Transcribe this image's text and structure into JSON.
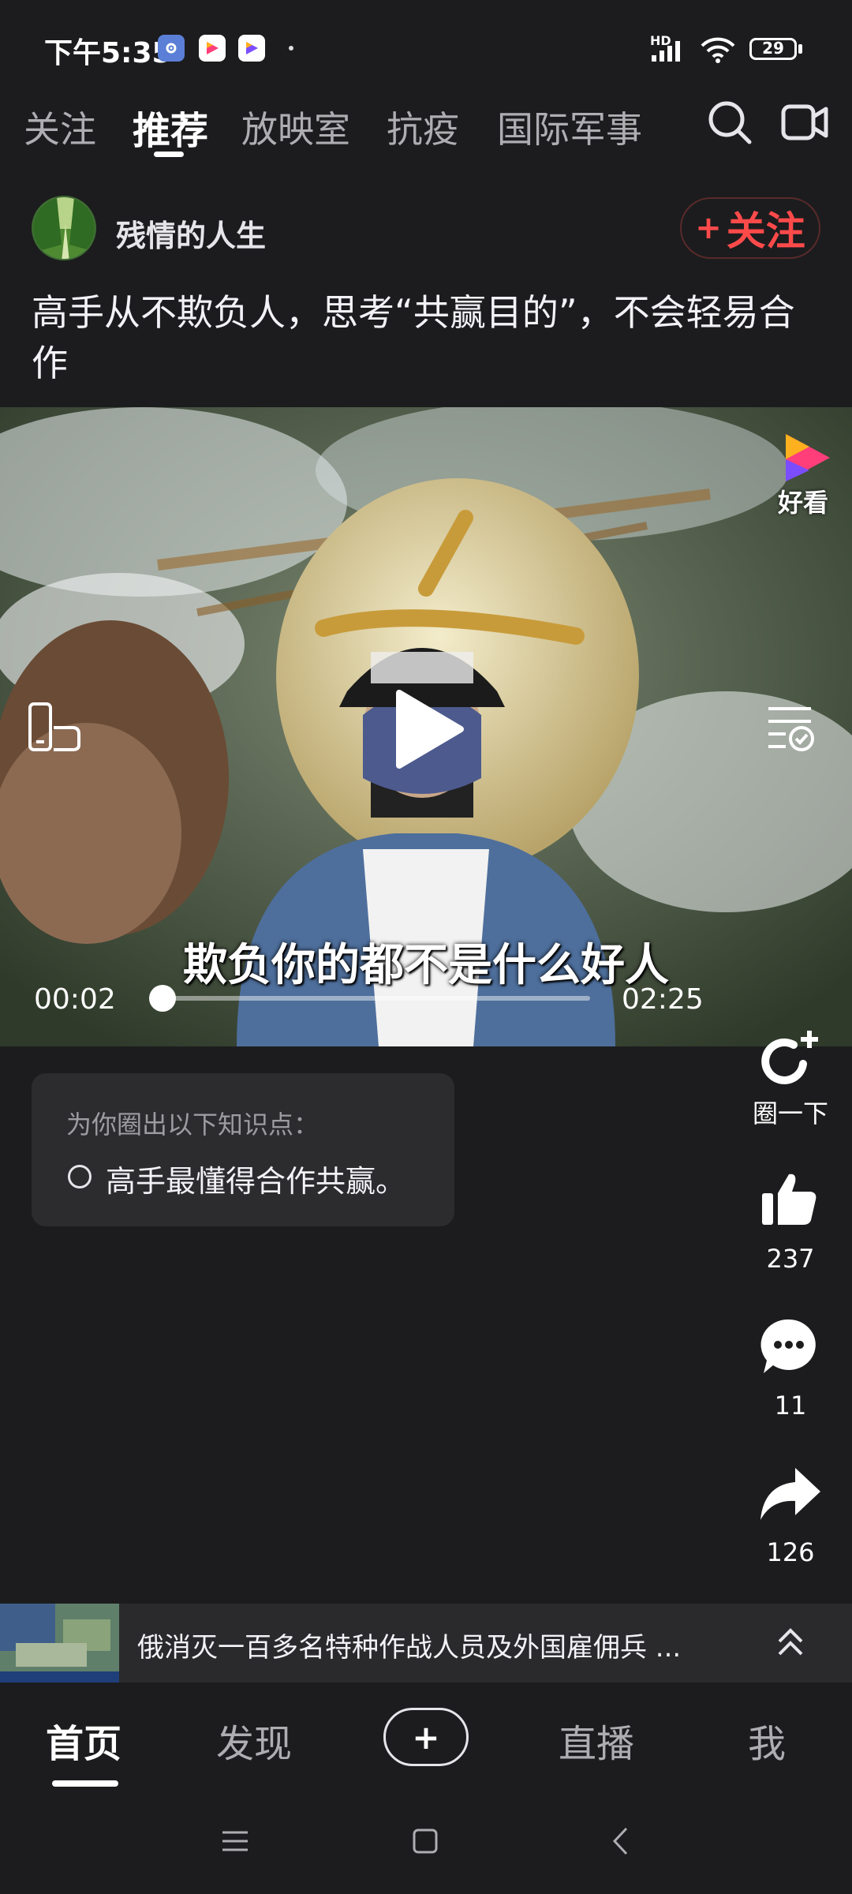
{
  "status_bar": {
    "time": "下午5:35",
    "network": "HD",
    "battery": "29"
  },
  "top_tabs": [
    {
      "label": "关注",
      "active": false
    },
    {
      "label": "推荐",
      "active": true
    },
    {
      "label": "放映室",
      "active": false
    },
    {
      "label": "抗疫",
      "active": false
    },
    {
      "label": "国际军事",
      "active": false
    }
  ],
  "author": {
    "name": "残情的人生",
    "follow_label": "关注"
  },
  "post": {
    "title": "高手从不欺负人，思考“共赢目的”，不会轻易合作"
  },
  "video": {
    "subtitle": "欺负你的都不是什么好人",
    "current_time": "00:02",
    "total_time": "02:25",
    "progress": 0.014,
    "brand_label": "好看"
  },
  "knowledge": {
    "title": "为你圈出以下知识点：",
    "items": [
      "高手最懂得合作共赢。"
    ]
  },
  "actions": {
    "circle_label": "圈一下",
    "like_count": "237",
    "comment_count": "11",
    "share_count": "126"
  },
  "mini_player": {
    "title": "俄消灭一百多名特种作战人员及外国雇佣兵 ..."
  },
  "bottom_nav": {
    "items": [
      "首页",
      "发现",
      "直播",
      "我"
    ],
    "plus_label": "+"
  },
  "colors": {
    "background": "#1c1c1e",
    "accent_red": "#ff4a4a",
    "text_primary": "#ffffff",
    "text_secondary": "#aeaeb2"
  },
  "icons": [
    "settings-app-icon",
    "haokan-app-icon",
    "search-icon",
    "camera-icon",
    "rotate-screen-icon",
    "play-icon",
    "playlist-icon",
    "circle-add-icon",
    "like-icon",
    "comment-icon",
    "share-icon",
    "expand-up-icon",
    "menu-icon",
    "home-icon",
    "back-icon"
  ]
}
